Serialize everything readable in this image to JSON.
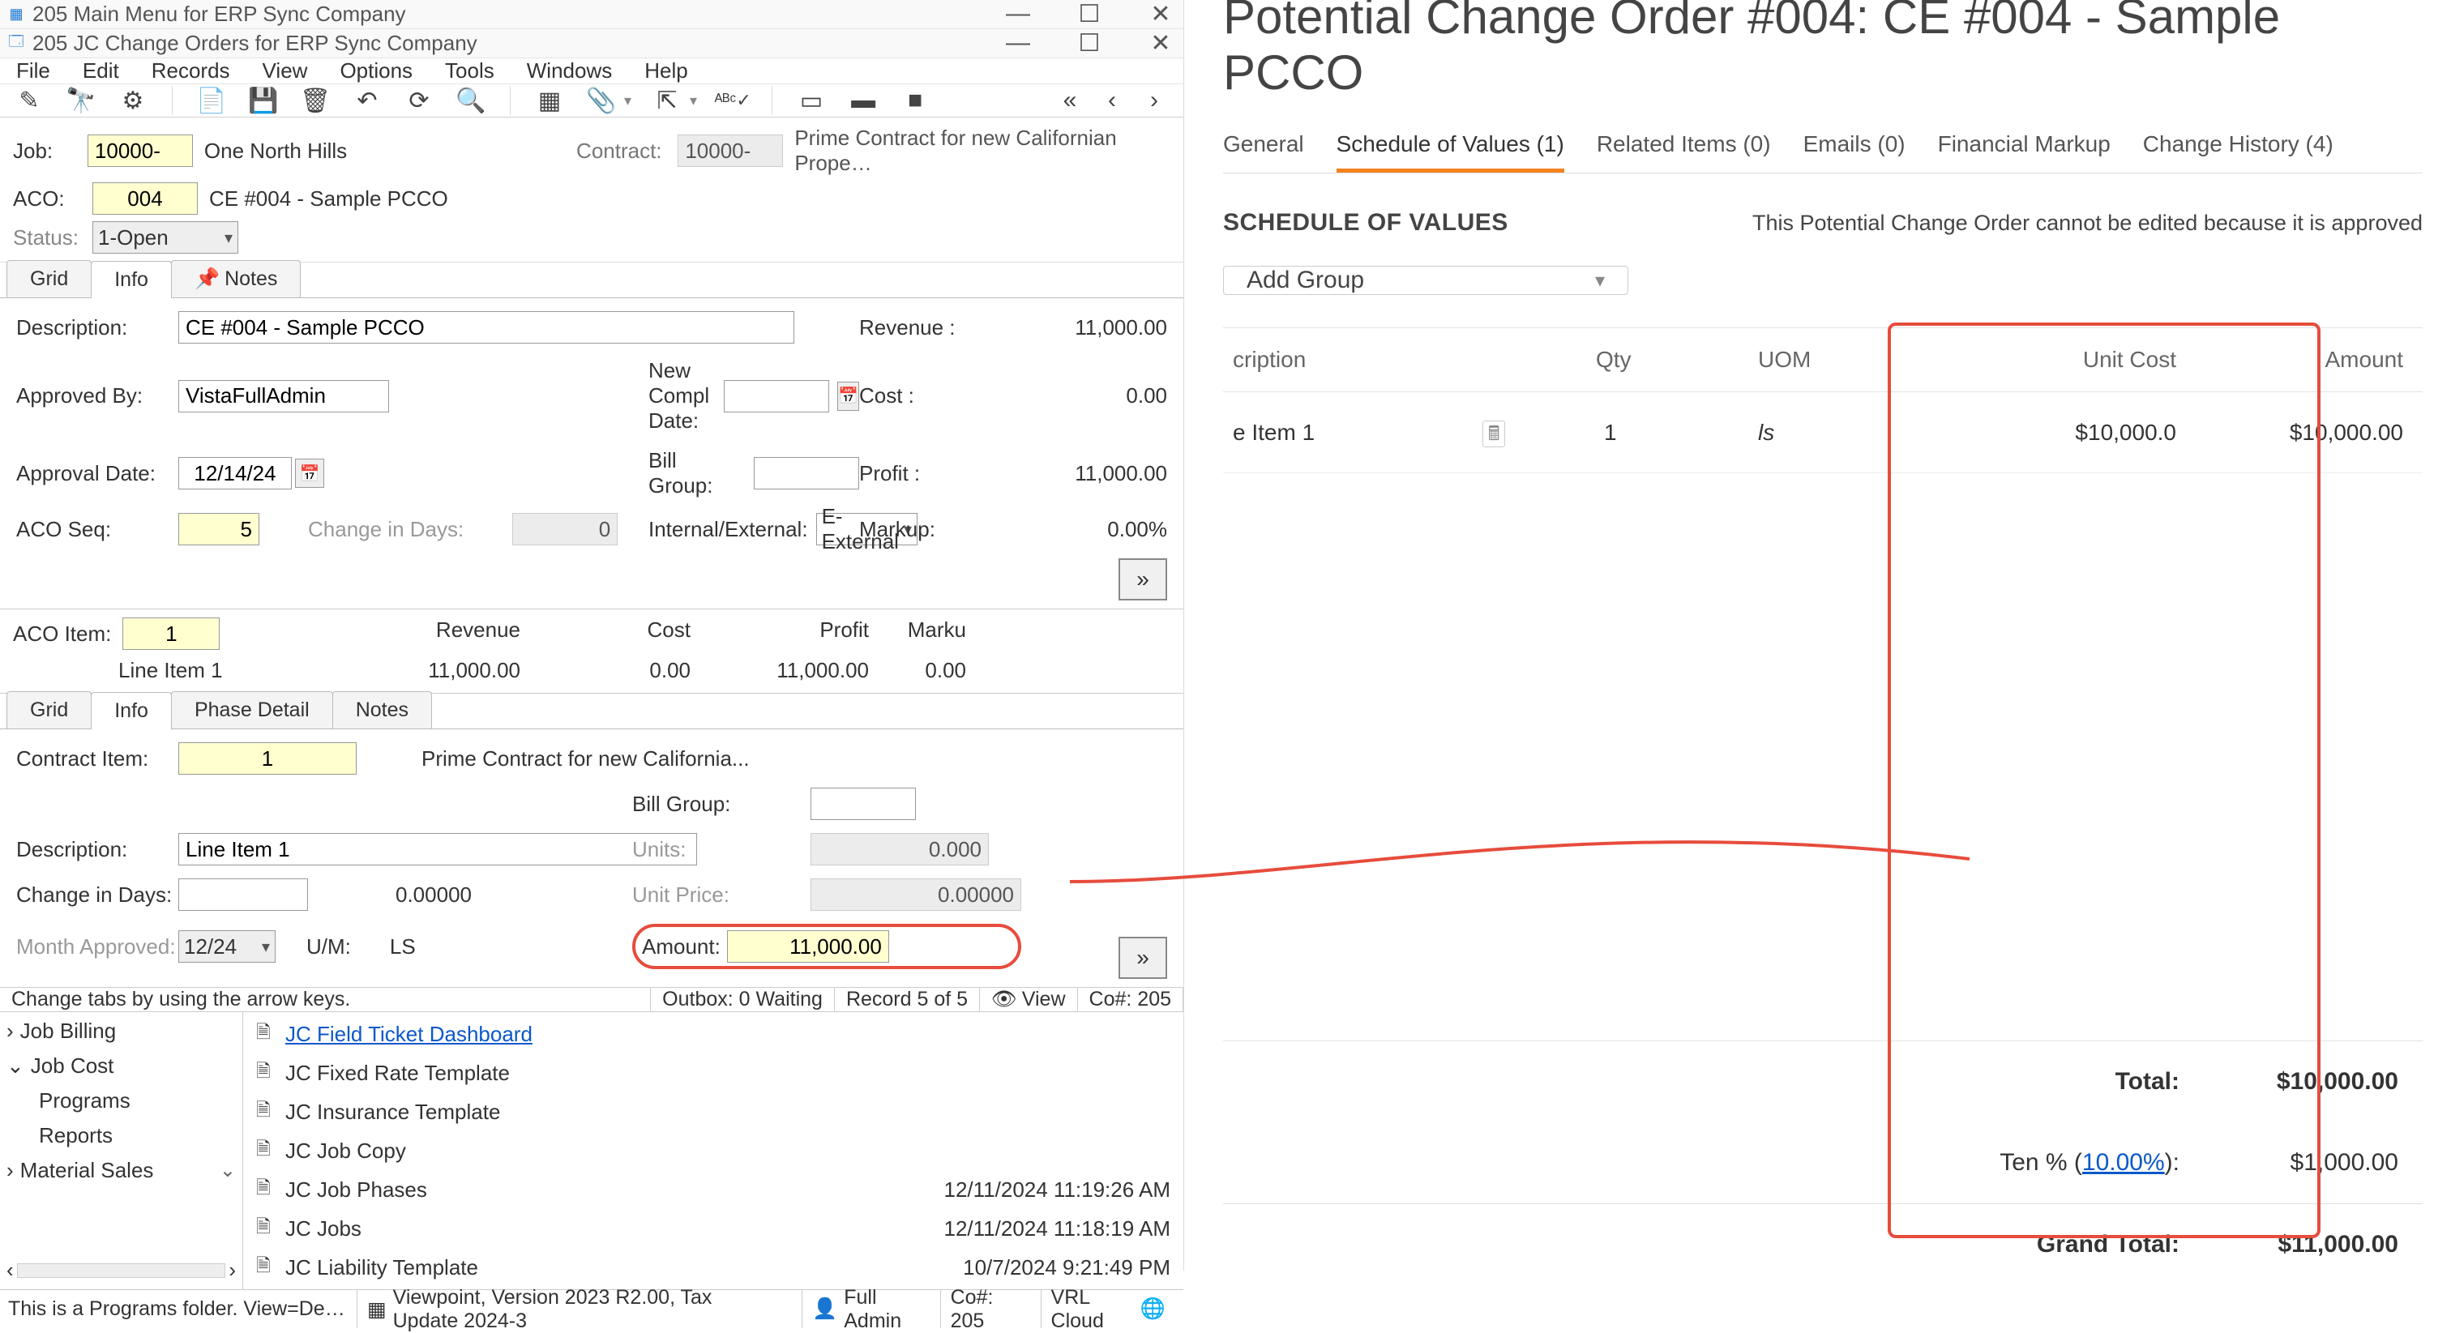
{
  "erp": {
    "main_title": "205 Main Menu for ERP Sync Company",
    "sub_title": "205 JC Change Orders for ERP Sync Company",
    "menu": [
      "File",
      "Edit",
      "Records",
      "View",
      "Options",
      "Tools",
      "Windows",
      "Help"
    ],
    "header": {
      "job_lbl": "Job:",
      "job_val": "10000-",
      "job_name": "One North Hills",
      "contract_lbl": "Contract:",
      "contract_val": "10000-",
      "contract_desc": "Prime Contract for new Californian Prope…",
      "aco_lbl": "ACO:",
      "aco_val": "004",
      "aco_name": "CE #004 - Sample PCCO",
      "status_lbl": "Status:",
      "status_val": "1-Open"
    },
    "tabs1": {
      "grid": "Grid",
      "info": "Info",
      "notes": "Notes"
    },
    "info": {
      "desc_lbl": "Description:",
      "desc_val": "CE #004 - Sample PCCO",
      "appby_lbl": "Approved By:",
      "appby_val": "VistaFullAdmin",
      "appdate_lbl": "Approval Date:",
      "appdate_val": "12/14/24",
      "acoseq_lbl": "ACO Seq:",
      "acoseq_val": "5",
      "chgdays_lbl": "Change in Days:",
      "chgdays_val": "0",
      "newcompl_lbl": "New Compl Date:",
      "billg_lbl": "Bill Group:",
      "intext_lbl": "Internal/External:",
      "intext_val": "E-External",
      "rev_lbl": "Revenue  :",
      "rev_val": "11,000.00",
      "cost_lbl": "Cost  :",
      "cost_val": "0.00",
      "profit_lbl": "Profit  :",
      "profit_val": "11,000.00",
      "markup_lbl": "Markup:",
      "markup_val": "0.00%"
    },
    "acoitem": {
      "lbl": "ACO Item:",
      "val": "1",
      "desc": "Line Item 1",
      "cols": {
        "rev": "Revenue",
        "cost": "Cost",
        "profit": "Profit",
        "markup": "Marku"
      },
      "vals": {
        "rev": "11,000.00",
        "cost": "0.00",
        "profit": "11,000.00",
        "markup": "0.00"
      }
    },
    "tabs2": {
      "grid": "Grid",
      "info": "Info",
      "phase": "Phase Detail",
      "notes": "Notes"
    },
    "contract": {
      "item_lbl": "Contract Item:",
      "item_val": "1",
      "item_desc": "Prime Contract for new California...",
      "desc_lbl": "Description:",
      "desc_val": "Line Item 1",
      "chg_lbl": "Change in Days:",
      "chg_val": "0.00000",
      "month_lbl": "Month Approved:",
      "month_val": "12/24",
      "um_lbl": "U/M:",
      "um_val": "LS",
      "bill_lbl": "Bill Group:",
      "units_lbl": "Units:",
      "units_val": "0.000",
      "uprice_lbl": "Unit Price:",
      "uprice_val": "0.00000",
      "amount_lbl": "Amount:",
      "amount_val": "11,000.00"
    },
    "status": {
      "hint": "Change tabs by using the arrow keys.",
      "outbox": "Outbox: 0 Waiting",
      "record": "Record 5 of 5",
      "view": "View",
      "co": "Co#: 205"
    },
    "tree": {
      "jobbilling": "Job Billing",
      "jobcost": "Job Cost",
      "programs": "Programs",
      "reports": "Reports",
      "matsales": "Material Sales"
    },
    "files": [
      {
        "name": "JC Field Ticket Dashboard",
        "link": true,
        "time": ""
      },
      {
        "name": "JC Fixed Rate Template",
        "link": false,
        "time": ""
      },
      {
        "name": "JC Insurance Template",
        "link": false,
        "time": ""
      },
      {
        "name": "JC Job Copy",
        "link": false,
        "time": ""
      },
      {
        "name": "JC Job Phases",
        "link": false,
        "time": "12/11/2024 11:19:26 AM"
      },
      {
        "name": "JC Jobs",
        "link": false,
        "time": "12/11/2024 11:18:19 AM"
      },
      {
        "name": "JC Liability Template",
        "link": false,
        "time": "10/7/2024 9:21:49 PM"
      }
    ],
    "bottomstatus": {
      "folder": "This is a Programs folder. View=Details. Sor",
      "version": "Viewpoint, Version 2023 R2.00, Tax Update 2024-3",
      "user": "Full Admin",
      "co": "Co#: 205",
      "server": "VRL Cloud"
    }
  },
  "web": {
    "title": "Potential Change Order #004: CE #004 - Sample PCCO",
    "tabs": [
      {
        "label": "General"
      },
      {
        "label": "Schedule of Values (1)",
        "active": true
      },
      {
        "label": "Related Items (0)"
      },
      {
        "label": "Emails (0)"
      },
      {
        "label": "Financial Markup"
      },
      {
        "label": "Change History (4)"
      }
    ],
    "sov_heading": "SCHEDULE OF VALUES",
    "approved_note": "This Potential Change Order cannot be edited because it is approved",
    "add_group": "Add Group",
    "cols": {
      "desc": "cription",
      "qty": "Qty",
      "uom": "UOM",
      "unit": "Unit Cost",
      "amount": "Amount"
    },
    "row": {
      "desc": "e Item 1",
      "qty": "1",
      "uom": "ls",
      "unit": "$10,000.0",
      "amount": "$10,000.00"
    },
    "totals": {
      "total_lbl": "Total:",
      "total_val": "$10,000.00",
      "ten_lbl_a": "Ten % (",
      "ten_pct": "10.00%",
      "ten_lbl_b": "):",
      "ten_val": "$1,000.00",
      "grand_lbl": "Grand Total:",
      "grand_val": "$11,000.00"
    }
  },
  "chart_data": {
    "type": "table",
    "title": "Schedule of Values — PCCO #004",
    "columns": [
      "Description",
      "Qty",
      "UOM",
      "Unit Cost",
      "Amount"
    ],
    "rows": [
      [
        "Line Item 1",
        1,
        "ls",
        10000.0,
        10000.0
      ]
    ],
    "subtotal": 10000.0,
    "markup": {
      "label": "Ten %",
      "percent": 10.0,
      "amount": 1000.0
    },
    "grand_total": 11000.0
  }
}
